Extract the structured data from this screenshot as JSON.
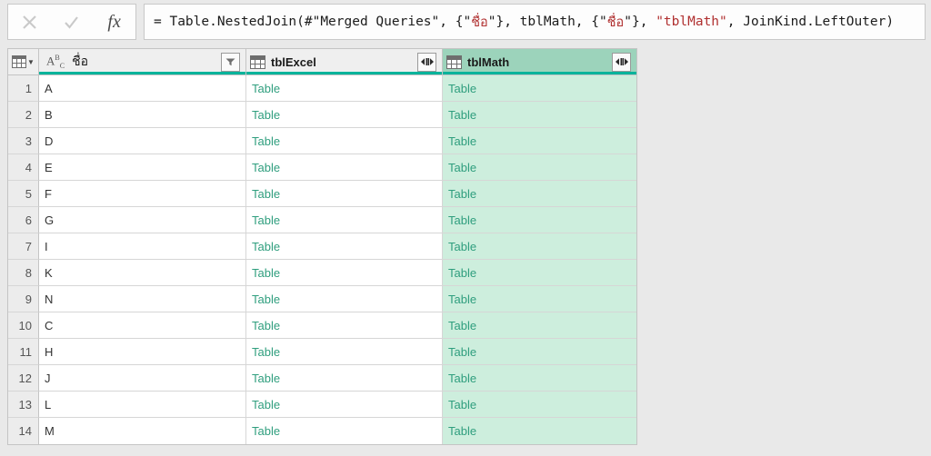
{
  "formula_bar": {
    "cancel_icon": "close-icon",
    "accept_icon": "check-icon",
    "fx_label": "fx",
    "formula_prefix": "= Table.NestedJoin(#\"Merged Queries\", {\"",
    "key_column": "ชื่อ",
    "formula_mid1": "\"}, tblMath, {\"",
    "formula_mid2": "\"}, ",
    "joined_table_literal": "\"tblMath\"",
    "formula_suffix": ", JoinKind.LeftOuter)",
    "full_formula": "= Table.NestedJoin(#\"Merged Queries\", {\"ชื่อ\"}, tblMath, {\"ชื่อ\"}, \"tblMath\", JoinKind.LeftOuter)"
  },
  "grid": {
    "corner_icon": "select-all-table-icon",
    "columns": [
      {
        "id": "col-name",
        "header": "ชื่อ",
        "type_icon": "abc-text-type-icon",
        "icon": null,
        "selected": true,
        "has_filter_dropdown": true,
        "has_expand_button": false,
        "bold": false
      },
      {
        "id": "col-tblexcel",
        "header": "tblExcel",
        "type_icon": null,
        "icon": "table-icon",
        "selected": true,
        "has_filter_dropdown": false,
        "has_expand_button": true,
        "bold": true
      },
      {
        "id": "col-tblmath",
        "header": "tblMath",
        "type_icon": null,
        "icon": "table-icon",
        "selected": true,
        "highlighted": true,
        "has_filter_dropdown": false,
        "has_expand_button": true,
        "bold": true
      }
    ],
    "expand_icon": "expand-columns-icon",
    "filter_icon": "filter-dropdown-icon",
    "rows": [
      {
        "num": "1",
        "name": "A",
        "tblExcel": "Table",
        "tblMath": "Table"
      },
      {
        "num": "2",
        "name": "B",
        "tblExcel": "Table",
        "tblMath": "Table"
      },
      {
        "num": "3",
        "name": "D",
        "tblExcel": "Table",
        "tblMath": "Table"
      },
      {
        "num": "4",
        "name": "E",
        "tblExcel": "Table",
        "tblMath": "Table"
      },
      {
        "num": "5",
        "name": "F",
        "tblExcel": "Table",
        "tblMath": "Table"
      },
      {
        "num": "6",
        "name": "G",
        "tblExcel": "Table",
        "tblMath": "Table"
      },
      {
        "num": "7",
        "name": "I",
        "tblExcel": "Table",
        "tblMath": "Table"
      },
      {
        "num": "8",
        "name": "K",
        "tblExcel": "Table",
        "tblMath": "Table"
      },
      {
        "num": "9",
        "name": "N",
        "tblExcel": "Table",
        "tblMath": "Table"
      },
      {
        "num": "10",
        "name": "C",
        "tblExcel": "Table",
        "tblMath": "Table"
      },
      {
        "num": "11",
        "name": "H",
        "tblExcel": "Table",
        "tblMath": "Table"
      },
      {
        "num": "12",
        "name": "J",
        "tblExcel": "Table",
        "tblMath": "Table"
      },
      {
        "num": "13",
        "name": "L",
        "tblExcel": "Table",
        "tblMath": "Table"
      },
      {
        "num": "14",
        "name": "M",
        "tblExcel": "Table",
        "tblMath": "Table"
      }
    ]
  },
  "colors": {
    "selection_underline": "#00b39b",
    "selected_column_header": "#9cd3bb",
    "selected_column_cell": "#cdeedd",
    "table_link": "#2f9e7e",
    "string_literal": "#b03030",
    "app_background": "#e9e9e9"
  }
}
